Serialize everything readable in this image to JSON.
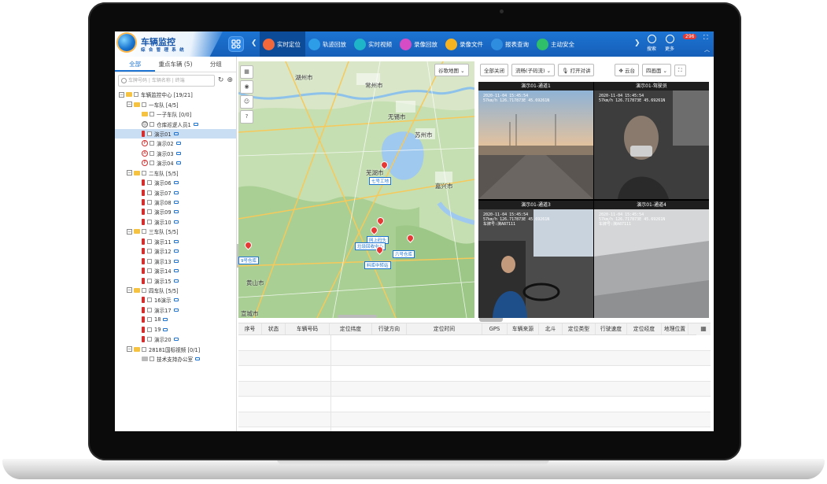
{
  "app": {
    "title": "车辆监控",
    "subtitle": "综 合 管 理 系 统"
  },
  "nav": {
    "items": [
      {
        "label": "实时定位",
        "color": "#f2683a",
        "active": true
      },
      {
        "label": "轨迹回放",
        "color": "#2e9de8"
      },
      {
        "label": "实时视频",
        "color": "#1fb5c9"
      },
      {
        "label": "录像回放",
        "color": "#d64cc4"
      },
      {
        "label": "录像文件",
        "color": "#f5b321"
      },
      {
        "label": "报表查询",
        "color": "#2f8de0"
      },
      {
        "label": "主动安全",
        "color": "#2fbf6a"
      }
    ],
    "search_label": "搜索",
    "more_label": "更多",
    "badge": "296"
  },
  "left": {
    "tabs": [
      "全部",
      "重点车辆 (5)",
      "分组"
    ],
    "search_placeholder": "车牌号码 | 车辆名称 | 终端",
    "tree": [
      {
        "label": "车辆监控中心 [19/21]",
        "level": 0,
        "type": "group"
      },
      {
        "label": "一车队 [4/5]",
        "level": 1,
        "type": "group"
      },
      {
        "label": "一子车队 [0/0]",
        "level": 2,
        "type": "folder"
      },
      {
        "label": "仓库巡逻人员1",
        "level": 2,
        "type": "person"
      },
      {
        "label": "演示01",
        "level": 2,
        "type": "vehicle",
        "selected": true
      },
      {
        "label": "演示02",
        "level": 2,
        "type": "badge",
        "mark": "P"
      },
      {
        "label": "演示03",
        "level": 2,
        "type": "badge",
        "mark": "A"
      },
      {
        "label": "演示04",
        "level": 2,
        "type": "badge",
        "mark": "P"
      },
      {
        "label": "二车队 [5/5]",
        "level": 1,
        "type": "group"
      },
      {
        "label": "演示06",
        "level": 2,
        "type": "vehicle"
      },
      {
        "label": "演示07",
        "level": 2,
        "type": "vehicle"
      },
      {
        "label": "演示08",
        "level": 2,
        "type": "vehicle"
      },
      {
        "label": "演示09",
        "level": 2,
        "type": "vehicle"
      },
      {
        "label": "演示10",
        "level": 2,
        "type": "vehicle"
      },
      {
        "label": "三车队 [5/5]",
        "level": 1,
        "type": "group"
      },
      {
        "label": "演示11",
        "level": 2,
        "type": "vehicle"
      },
      {
        "label": "演示12",
        "level": 2,
        "type": "vehicle"
      },
      {
        "label": "演示13",
        "level": 2,
        "type": "vehicle"
      },
      {
        "label": "演示14",
        "level": 2,
        "type": "vehicle"
      },
      {
        "label": "演示15",
        "level": 2,
        "type": "vehicle"
      },
      {
        "label": "四车队 [5/5]",
        "level": 1,
        "type": "group"
      },
      {
        "label": "16演示",
        "level": 2,
        "type": "vehicle"
      },
      {
        "label": "演示17",
        "level": 2,
        "type": "vehicle"
      },
      {
        "label": "18",
        "level": 2,
        "type": "vehicle"
      },
      {
        "label": "19",
        "level": 2,
        "type": "vehicle"
      },
      {
        "label": "演示20",
        "level": 2,
        "type": "vehicle"
      },
      {
        "label": "28181国标视频 [0/1]",
        "level": 1,
        "type": "group"
      },
      {
        "label": "技术支持办公室",
        "level": 2,
        "type": "office"
      }
    ]
  },
  "map": {
    "type_select": "谷歌地图",
    "cities": [
      "常州市",
      "无锡市",
      "苏州市",
      "宣城市",
      "嘉兴市",
      "芜湖市",
      "黄山市",
      "湖州市"
    ],
    "markers": [
      "七号工地",
      "网上码头",
      "垃圾回收中心",
      "六号仓库",
      "料库中转站",
      "9号仓库"
    ]
  },
  "video": {
    "toolbar": {
      "close_all": "全部关闭",
      "stream_select": "流畅(子码流)",
      "intercom": "打开对讲",
      "ptz": "云台",
      "layout_select": "四画面"
    },
    "channels": [
      {
        "title": "演示01-通道1",
        "osd": [
          "2020-11-04 15:45:54",
          "57km/h 126.717873E 45.69261N"
        ]
      },
      {
        "title": "演示01-驾驶员",
        "osd": [
          "2020-11-04 15:45:54",
          "57km/h 126.717873E 45.69261N"
        ]
      },
      {
        "title": "演示01-通道3",
        "osd": [
          "2020-11-04 15:45:54",
          "57km/h 126.717873E 45.69261N",
          "车牌号:演A87111"
        ]
      },
      {
        "title": "演示01-通道4",
        "osd": [
          "2020-11-04 15:45:54",
          "57km/h 126.717873E 45.69261N",
          "车牌号:演A87111"
        ]
      }
    ]
  },
  "table": {
    "columns": [
      "序号",
      "状态",
      "车辆号码",
      "定位纬度",
      "行驶方向",
      "定位时间",
      "GPS",
      "车辆来源",
      "北斗",
      "定位类型",
      "行驶速度",
      "定位经度",
      "地理位置"
    ],
    "rows": 7
  }
}
